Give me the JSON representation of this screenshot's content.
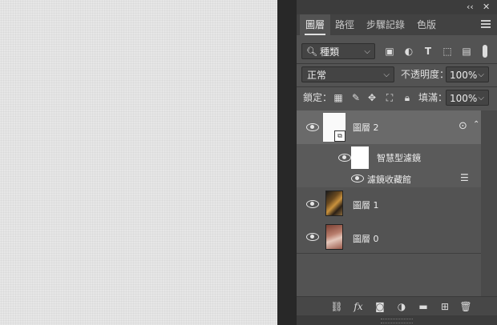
{
  "panel": {
    "collapse_glyph": "‹‹",
    "close_glyph": "✕",
    "tabs": [
      {
        "label": "圖層"
      },
      {
        "label": "路徑"
      },
      {
        "label": "步驟記錄"
      },
      {
        "label": "色版"
      }
    ],
    "filter": {
      "icon": "search-icon",
      "value": "種類"
    },
    "blend_mode": "正常",
    "opacity_label": "不透明度：",
    "opacity_value": "100%",
    "lock_label": "鎖定：",
    "fill_label": "填滿：",
    "fill_value": "100%",
    "layers": [
      {
        "name": "圖層 2",
        "selected": true
      },
      {
        "name": "智慧型濾鏡"
      },
      {
        "name": "濾鏡收藏館"
      },
      {
        "name": "圖層 1"
      },
      {
        "name": "圖層 0"
      }
    ]
  },
  "colors": {
    "panel_bg": "#535353",
    "selected_row": "#6a6a6a",
    "canvas": "#e6e6e6"
  }
}
